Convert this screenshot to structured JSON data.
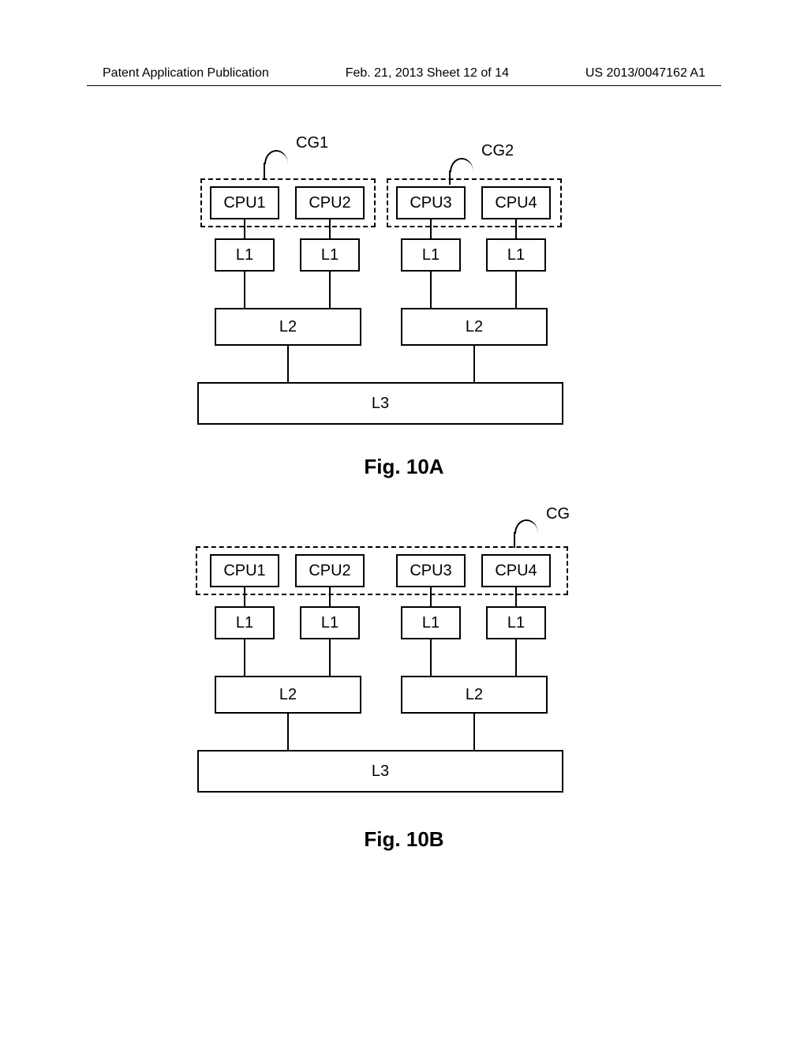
{
  "header": {
    "left": "Patent Application Publication",
    "center": "Feb. 21, 2013  Sheet 12 of 14",
    "right": "US 2013/0047162 A1"
  },
  "figA": {
    "label_cg1": "CG1",
    "label_cg2": "CG2",
    "cpu1": "CPU1",
    "cpu2": "CPU2",
    "cpu3": "CPU3",
    "cpu4": "CPU4",
    "l1_1": "L1",
    "l1_2": "L1",
    "l1_3": "L1",
    "l1_4": "L1",
    "l2_1": "L2",
    "l2_2": "L2",
    "l3": "L3",
    "caption": "Fig. 10A"
  },
  "figB": {
    "label_cg": "CG",
    "cpu1": "CPU1",
    "cpu2": "CPU2",
    "cpu3": "CPU3",
    "cpu4": "CPU4",
    "l1_1": "L1",
    "l1_2": "L1",
    "l1_3": "L1",
    "l1_4": "L1",
    "l2_1": "L2",
    "l2_2": "L2",
    "l3": "L3",
    "caption": "Fig. 10B"
  }
}
